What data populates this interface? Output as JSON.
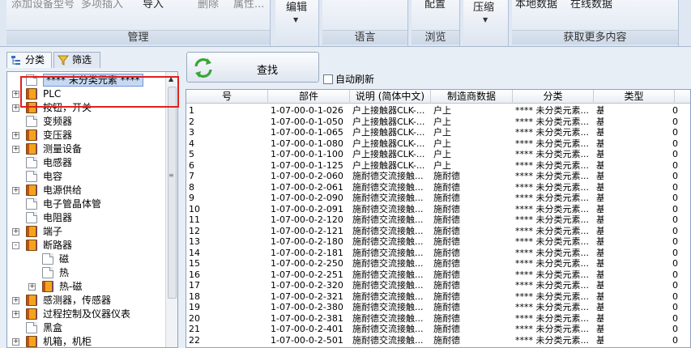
{
  "ribbon": {
    "buttons_top": {
      "add_model": "添加设备型号",
      "batch_import": "多项插入",
      "import": "导入",
      "delete": "删除",
      "properties": "属性...",
      "edit": "编辑",
      "config": "配置",
      "compress": "压缩",
      "local_data": "本地数据",
      "online_data": "在线数据"
    },
    "groups": {
      "manage": "管理",
      "language": "语言",
      "browse": "浏览",
      "more_content": "获取更多内容"
    }
  },
  "left": {
    "tabs": [
      {
        "label": "分类",
        "icon": "tree-icon"
      },
      {
        "label": "筛选",
        "icon": "filter-funnel-icon"
      }
    ],
    "tree": [
      {
        "label": "**** 未分类元素 ****",
        "expander": "",
        "icon": "doc",
        "indent": 0,
        "selected": true
      },
      {
        "label": "PLC",
        "expander": "+",
        "icon": "book",
        "indent": 0
      },
      {
        "label": "按钮，开关",
        "expander": "+",
        "icon": "book",
        "indent": 0
      },
      {
        "label": "变频器",
        "expander": "",
        "icon": "doc",
        "indent": 0
      },
      {
        "label": "变压器",
        "expander": "+",
        "icon": "book",
        "indent": 0
      },
      {
        "label": "测量设备",
        "expander": "+",
        "icon": "book",
        "indent": 0
      },
      {
        "label": "电感器",
        "expander": "",
        "icon": "doc",
        "indent": 0
      },
      {
        "label": "电容",
        "expander": "",
        "icon": "doc",
        "indent": 0
      },
      {
        "label": "电源供给",
        "expander": "+",
        "icon": "book",
        "indent": 0
      },
      {
        "label": "电子管晶体管",
        "expander": "",
        "icon": "doc",
        "indent": 0
      },
      {
        "label": "电阻器",
        "expander": "",
        "icon": "doc",
        "indent": 0
      },
      {
        "label": "端子",
        "expander": "+",
        "icon": "book",
        "indent": 0
      },
      {
        "label": "断路器",
        "expander": "-",
        "icon": "book",
        "indent": 0
      },
      {
        "label": "磁",
        "expander": "",
        "icon": "doc",
        "indent": 1
      },
      {
        "label": "热",
        "expander": "",
        "icon": "doc",
        "indent": 1
      },
      {
        "label": "热-磁",
        "expander": "+",
        "icon": "book",
        "indent": 1
      },
      {
        "label": "感测器，传感器",
        "expander": "+",
        "icon": "book",
        "indent": 0
      },
      {
        "label": "过程控制及仪器仪表",
        "expander": "+",
        "icon": "book",
        "indent": 0
      },
      {
        "label": "黑盒",
        "expander": "",
        "icon": "doc",
        "indent": 0
      },
      {
        "label": "机箱，机柜",
        "expander": "+",
        "icon": "book",
        "indent": 0
      }
    ]
  },
  "right": {
    "find_label": "查找",
    "auto_refresh_label": "自动刷新",
    "auto_refresh_checked": false,
    "columns": [
      "号",
      "部件",
      "说明 (简体中文)",
      "制造商数据",
      "分类",
      "类型"
    ],
    "rows": [
      [
        "1",
        "1-07-00-0-1-026",
        "户上接触器CLK-...",
        "户上",
        "**** 未分类元素...",
        "基",
        "0"
      ],
      [
        "2",
        "1-07-00-0-1-050",
        "户上接触器CLK-...",
        "户上",
        "**** 未分类元素...",
        "基",
        "0"
      ],
      [
        "3",
        "1-07-00-0-1-065",
        "户上接触器CLK-...",
        "户上",
        "**** 未分类元素...",
        "基",
        "0"
      ],
      [
        "4",
        "1-07-00-0-1-080",
        "户上接触器CLK-...",
        "户上",
        "**** 未分类元素...",
        "基",
        "0"
      ],
      [
        "5",
        "1-07-00-0-1-100",
        "户上接触器CLK-...",
        "户上",
        "**** 未分类元素...",
        "基",
        "0"
      ],
      [
        "6",
        "1-07-00-0-1-125",
        "户上接触器CLK-...",
        "户上",
        "**** 未分类元素...",
        "基",
        "0"
      ],
      [
        "7",
        "1-07-00-0-2-060",
        "施耐德交流接触...",
        "施耐德",
        "**** 未分类元素...",
        "基",
        "0"
      ],
      [
        "8",
        "1-07-00-0-2-061",
        "施耐德交流接触...",
        "施耐德",
        "**** 未分类元素...",
        "基",
        "0"
      ],
      [
        "9",
        "1-07-00-0-2-090",
        "施耐德交流接触...",
        "施耐德",
        "**** 未分类元素...",
        "基",
        "0"
      ],
      [
        "10",
        "1-07-00-0-2-091",
        "施耐德交流接触...",
        "施耐德",
        "**** 未分类元素...",
        "基",
        "0"
      ],
      [
        "11",
        "1-07-00-0-2-120",
        "施耐德交流接触...",
        "施耐德",
        "**** 未分类元素...",
        "基",
        "0"
      ],
      [
        "12",
        "1-07-00-0-2-121",
        "施耐德交流接触...",
        "施耐德",
        "**** 未分类元素...",
        "基",
        "0"
      ],
      [
        "13",
        "1-07-00-0-2-180",
        "施耐德交流接触...",
        "施耐德",
        "**** 未分类元素...",
        "基",
        "0"
      ],
      [
        "14",
        "1-07-00-0-2-181",
        "施耐德交流接触...",
        "施耐德",
        "**** 未分类元素...",
        "基",
        "0"
      ],
      [
        "15",
        "1-07-00-0-2-250",
        "施耐德交流接触...",
        "施耐德",
        "**** 未分类元素...",
        "基",
        "0"
      ],
      [
        "16",
        "1-07-00-0-2-251",
        "施耐德交流接触...",
        "施耐德",
        "**** 未分类元素...",
        "基",
        "0"
      ],
      [
        "17",
        "1-07-00-0-2-320",
        "施耐德交流接触...",
        "施耐德",
        "**** 未分类元素...",
        "基",
        "0"
      ],
      [
        "18",
        "1-07-00-0-2-321",
        "施耐德交流接触...",
        "施耐德",
        "**** 未分类元素...",
        "基",
        "0"
      ],
      [
        "19",
        "1-07-00-0-2-380",
        "施耐德交流接触...",
        "施耐德",
        "**** 未分类元素...",
        "基",
        "0"
      ],
      [
        "20",
        "1-07-00-0-2-381",
        "施耐德交流接触...",
        "施耐德",
        "**** 未分类元素...",
        "基",
        "0"
      ],
      [
        "21",
        "1-07-00-0-2-401",
        "施耐德交流接触...",
        "施耐德",
        "**** 未分类元素...",
        "基",
        "0"
      ],
      [
        "22",
        "1-07-00-0-2-501",
        "施耐德交流接触...",
        "施耐德",
        "**** 未分类元素...",
        "基",
        "0"
      ]
    ]
  },
  "colors": {
    "highlight_box": "#e0201d",
    "selection": "#c7d8f2",
    "ribbon_bg": "#dfe7f2"
  }
}
